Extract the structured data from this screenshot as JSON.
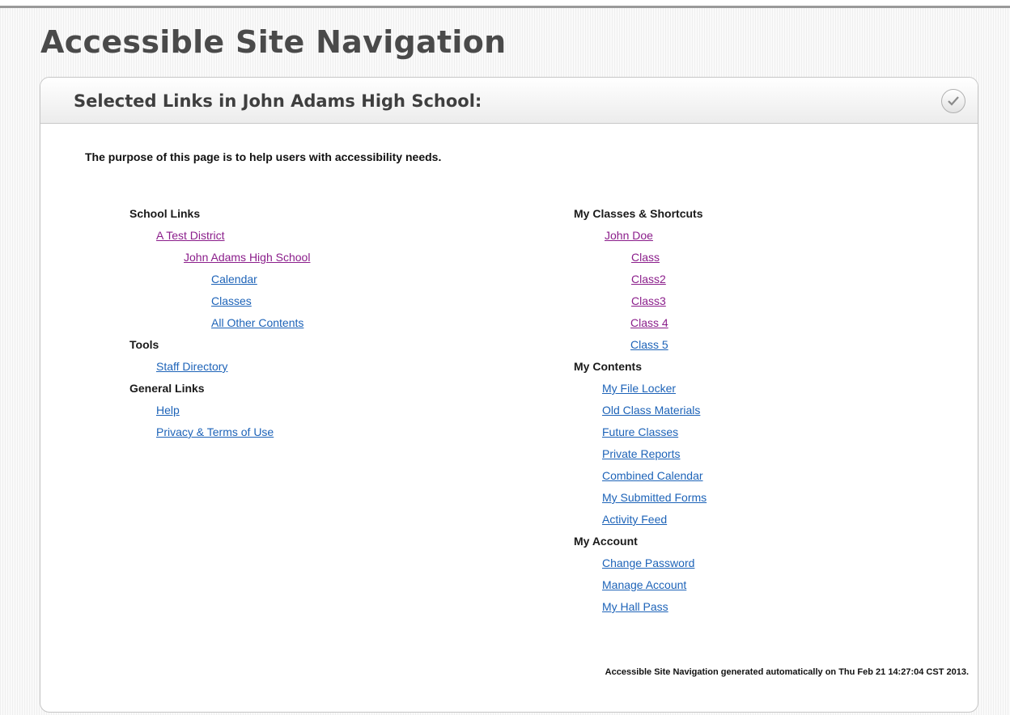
{
  "page": {
    "title": "Accessible Site Navigation"
  },
  "panel": {
    "title": "Selected Links in John Adams High School:",
    "collapse_icon": "check-circle-icon"
  },
  "purpose_text": "The purpose of this page is to help users with accessibility needs.",
  "left": {
    "school_links": {
      "heading": "School Links",
      "district": "A Test District",
      "school": "John Adams High School",
      "calendar": "Calendar",
      "classes": "Classes",
      "other": "All Other Contents"
    },
    "tools": {
      "heading": "Tools",
      "staff_directory": "Staff Directory"
    },
    "general": {
      "heading": "General Links",
      "help": "Help",
      "privacy": "Privacy & Terms of Use"
    }
  },
  "right": {
    "classes": {
      "heading": "My Classes & Shortcuts",
      "user": "John Doe",
      "items": [
        "Class",
        "Class2",
        "Class3",
        "Class 4",
        "Class 5"
      ]
    },
    "contents": {
      "heading": "My Contents",
      "items": [
        "My File Locker",
        "Old Class Materials",
        "Future Classes",
        "Private Reports",
        "Combined Calendar",
        "My Submitted Forms",
        "Activity Feed"
      ]
    },
    "account": {
      "heading": "My Account",
      "items": [
        "Change Password",
        "Manage Account",
        "My Hall Pass"
      ]
    }
  },
  "footer": "Accessible Site Navigation generated automatically on Thu Feb 21 14:27:04 CST 2013.",
  "colors": {
    "link": "#1d63b8",
    "visited_link": "#8b1e8b",
    "title": "#4a4a4a"
  }
}
